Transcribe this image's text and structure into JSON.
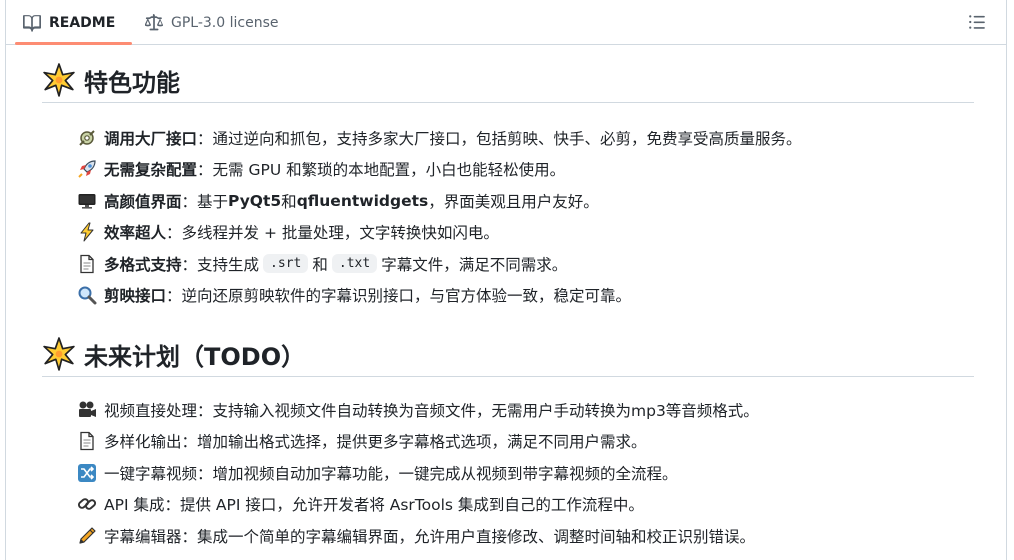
{
  "tabs": {
    "readme_label": "README",
    "license_label": "GPL-3.0 license"
  },
  "sections": {
    "features_title": "特色功能",
    "todo_title": "未来计划（TODO）"
  },
  "features": [
    {
      "icon": "gear-plug-icon",
      "title": "调用大厂接口",
      "sep": "：",
      "text": "通过逆向和抓包，支持多家大厂接口，包括剪映、快手、必剪，免费享受高质量服务。"
    },
    {
      "icon": "rocket-icon",
      "title": "无需复杂配置",
      "sep": "：",
      "text": "无需 GPU 和繁琐的本地配置，小白也能轻松使用。"
    },
    {
      "icon": "monitor-icon",
      "title": "高颜值界面",
      "sep": "：",
      "text_a": "基于 ",
      "b1": "PyQt5",
      "text_b": " 和 ",
      "b2": "qfluentwidgets",
      "text_c": "，界面美观且用户友好。"
    },
    {
      "icon": "lightning-icon",
      "title": "效率超人",
      "sep": "：",
      "text": "多线程并发 + 批量处理，文字转换快如闪电。"
    },
    {
      "icon": "document-icon",
      "title": "多格式支持",
      "sep": "：",
      "text_a": "支持生成 ",
      "code1": ".srt",
      "text_b": " 和 ",
      "code2": ".txt",
      "text_c": " 字幕文件，满足不同需求。"
    },
    {
      "icon": "magnifier-icon",
      "title": "剪映接口",
      "sep": "：",
      "text": "逆向还原剪映软件的字幕识别接口，与官方体验一致，稳定可靠。"
    }
  ],
  "todo": [
    {
      "icon": "film-camera-icon",
      "text": "视频直接处理：支持输入视频文件自动转换为音频文件，无需用户手动转换为mp3等音频格式。"
    },
    {
      "icon": "document-icon",
      "text": "多样化输出：增加输出格式选择，提供更多字幕格式选项，满足不同用户需求。"
    },
    {
      "icon": "shuffle-icon",
      "text": "一键字幕视频：增加视频自动加字幕功能，一键完成从视频到带字幕视频的全流程。"
    },
    {
      "icon": "link-icon",
      "text": "API 集成：提供 API 接口，允许开发者将 AsrTools 集成到自己的工作流程中。"
    },
    {
      "icon": "pencil-icon",
      "text": "字幕编辑器：集成一个简单的字幕编辑界面，允许用户直接修改、调整时间轴和校正识别错误。"
    }
  ],
  "colors": {
    "accent_underline": "#fd8c73",
    "border": "#d1d9e0",
    "text": "#1f2328",
    "muted": "#59636e"
  }
}
